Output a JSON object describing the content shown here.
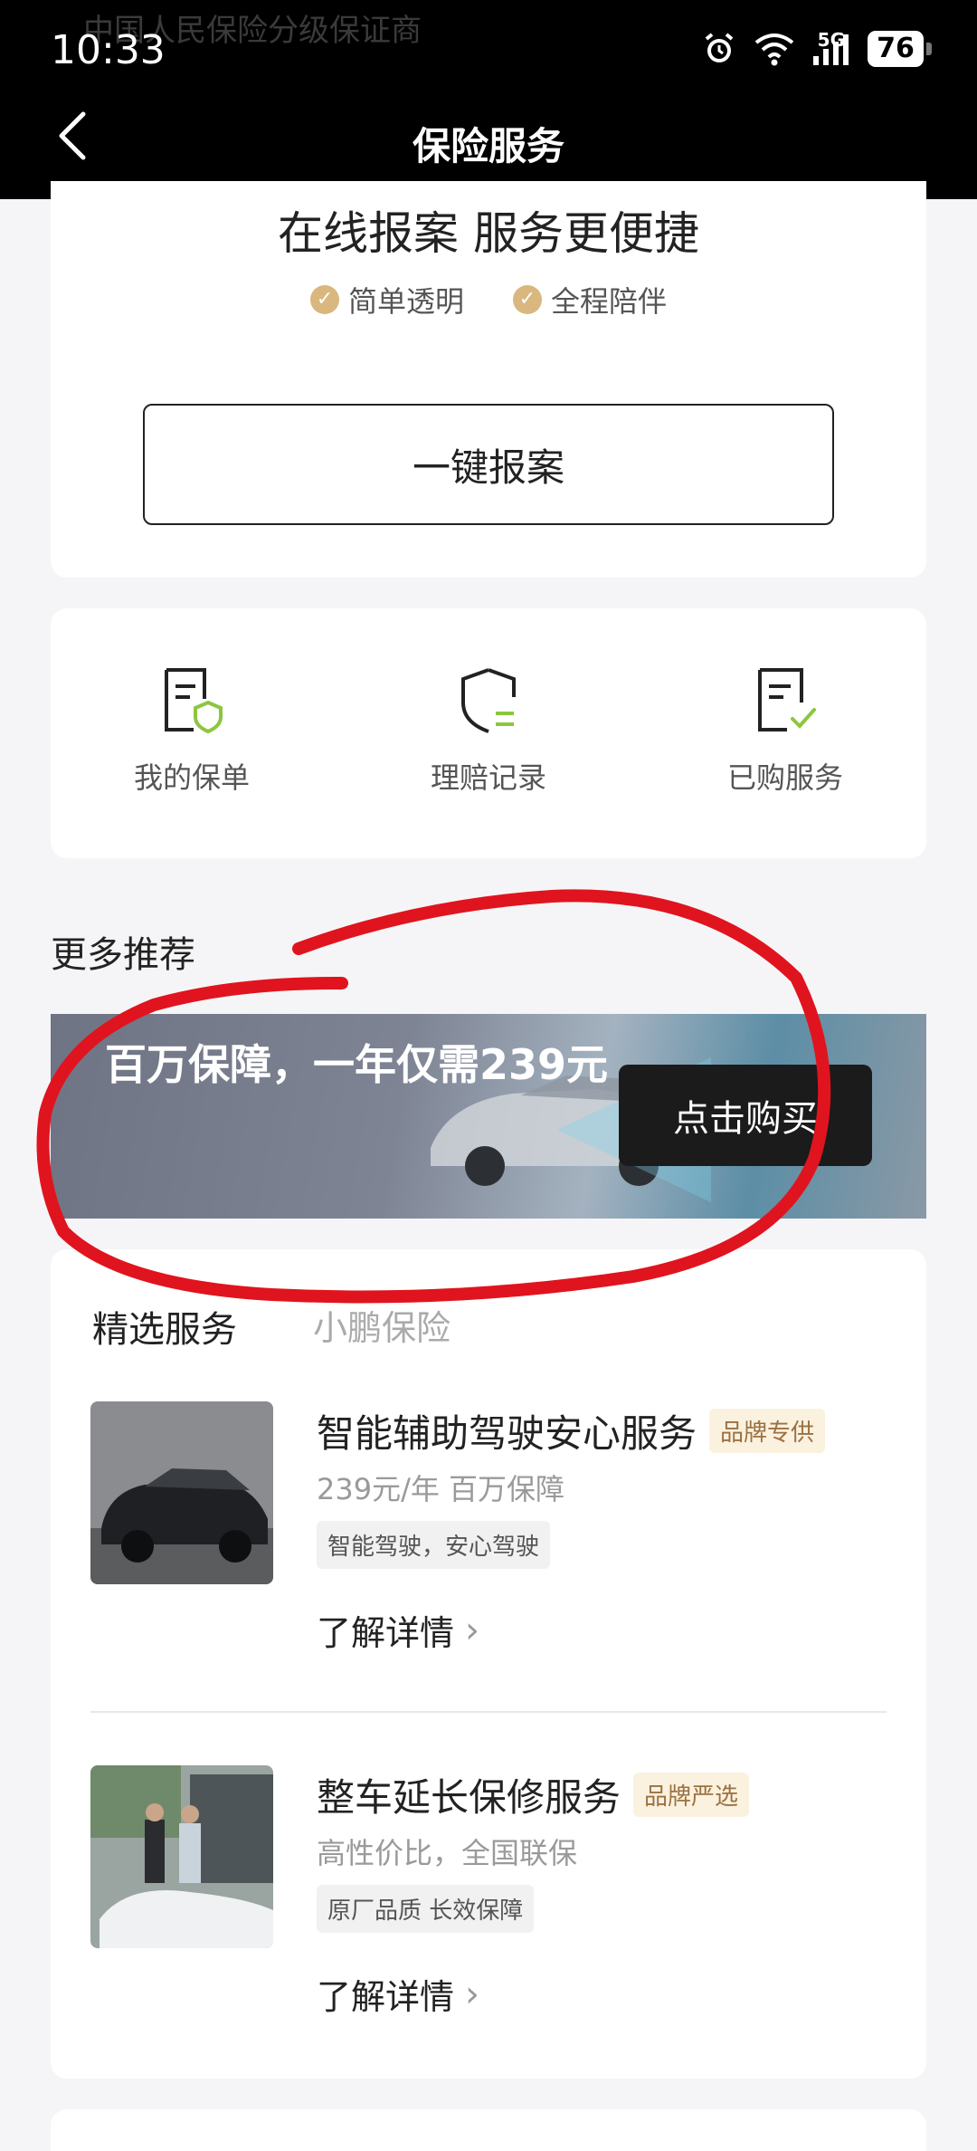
{
  "status_bar": {
    "time": "10:33",
    "network": "5G",
    "battery": "76",
    "ghost_text": "中国人民保险分级保证商"
  },
  "header": {
    "title": "保险服务"
  },
  "report_card": {
    "headline": "在线报案 服务更便捷",
    "tags": [
      "简单透明",
      "全程陪伴"
    ],
    "button": "一键报案"
  },
  "quick_actions": [
    {
      "label": "我的保单",
      "icon": "policy-shield-icon"
    },
    {
      "label": "理赔记录",
      "icon": "shield-list-icon"
    },
    {
      "label": "已购服务",
      "icon": "document-check-icon"
    }
  ],
  "recommend": {
    "title": "更多推荐",
    "banner_text": "百万保障，一年仅需239元",
    "banner_button": "点击购买"
  },
  "selected": {
    "title": "精选服务",
    "subtitle": "小鹏保险",
    "items": [
      {
        "name": "智能辅助驾驶安心服务",
        "badge": "品牌专供",
        "meta": "239元/年 百万保障",
        "chip": "智能驾驶，安心驾驶",
        "more": "了解详情"
      },
      {
        "name": "整车延长保修服务",
        "badge": "品牌严选",
        "meta": "高性价比，全国联保",
        "chip": "原厂品质 长效保障",
        "more": "了解详情"
      }
    ]
  },
  "colors": {
    "accent_gold": "#d9b77e",
    "header_bg": "#000000",
    "annotation_red": "#e0141e",
    "icon_green": "#8cc63f"
  }
}
